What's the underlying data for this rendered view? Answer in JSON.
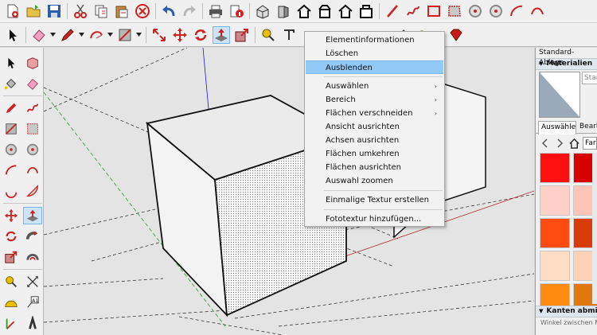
{
  "context_menu": {
    "items": [
      {
        "label": "Elementinformationen",
        "submenu": false,
        "highlighted": false
      },
      {
        "label": "Löschen",
        "submenu": false,
        "highlighted": false
      },
      {
        "label": "Ausblenden",
        "submenu": false,
        "highlighted": true
      },
      {
        "separator": true
      },
      {
        "label": "Auswählen",
        "submenu": true,
        "highlighted": false
      },
      {
        "label": "Bereich",
        "submenu": true,
        "highlighted": false
      },
      {
        "label": "Flächen verschneiden",
        "submenu": true,
        "highlighted": false
      },
      {
        "label": "Ansicht ausrichten",
        "submenu": false,
        "highlighted": false
      },
      {
        "label": "Achsen ausrichten",
        "submenu": false,
        "highlighted": false
      },
      {
        "label": "Flächen umkehren",
        "submenu": false,
        "highlighted": false
      },
      {
        "label": "Flächen ausrichten",
        "submenu": false,
        "highlighted": false
      },
      {
        "label": "Auswahl zoomen",
        "submenu": false,
        "highlighted": false
      },
      {
        "separator": true
      },
      {
        "label": "Einmalige Textur erstellen",
        "submenu": false,
        "highlighted": false
      },
      {
        "separator": true
      },
      {
        "label": "Fototextur hinzufügen...",
        "submenu": false,
        "highlighted": false
      }
    ],
    "submenu_arrow": "›"
  },
  "tray": {
    "title": "Standard-Ablage",
    "materials_header": "Materialien",
    "material_name_field": "Stan",
    "tab_select": "Auswählen",
    "tab_edit": "Bearb",
    "library_select": "Farb",
    "edges_header": "Kanten abmild",
    "angle_text": "Winkel zwischen No",
    "collapse_glyph": "▼",
    "swatch_colors": [
      "#ff1010",
      "#d80000",
      "#ffd0c8",
      "#ffc4b8",
      "#ff4a10",
      "#d83a08",
      "#ffdcc4",
      "#ffd2b8",
      "#ff8c10",
      "#e07810"
    ]
  },
  "toolbar_top": {
    "icons": [
      "new-icon",
      "open-icon",
      "save-icon",
      "cut-icon",
      "copy-icon",
      "paste-icon",
      "erase-icon",
      "undo-icon",
      "redo-icon",
      "print-icon",
      "model-info-icon",
      "iso-view-icon",
      "top-view-icon",
      "front-view-icon",
      "right-view-icon",
      "back-view-icon",
      "left-view-icon",
      "line-icon",
      "freehand-icon",
      "rectangle-icon",
      "rotated-rect-icon",
      "circle-icon",
      "polygon-icon",
      "arc-icon",
      "pie-icon"
    ]
  },
  "toolbar_second": {
    "icons": [
      "select-icon",
      "eraser-icon",
      "pencil-icon",
      "arc-tool-icon",
      "shape-icon",
      "offset-icon",
      "move-icon",
      "rotate-icon",
      "push-pull-icon",
      "scale-icon",
      "tape-measure-icon",
      "text-icon",
      "paint-icon",
      "components-icon",
      "ruby-icon"
    ]
  },
  "tool_palette": {
    "icons": [
      "select-arrow-icon",
      "make-component-icon",
      "paint-bucket-icon",
      "eraser-icon",
      "line-icon",
      "freehand-icon",
      "rectangle-icon",
      "rotated-rectangle-icon",
      "circle-icon",
      "polygon-icon",
      "arc-icon",
      "two-point-arc-icon",
      "three-point-arc-icon",
      "pie-icon",
      "move-icon",
      "push-pull-icon",
      "rotate-icon",
      "follow-me-icon",
      "scale-icon",
      "offset-icon",
      "tape-measure-icon",
      "dimension-icon",
      "protractor-icon",
      "text-label-icon",
      "axes-icon",
      "3d-text-icon"
    ],
    "active": "push-pull-icon",
    "text_label_glyph": "A1"
  },
  "colors": {
    "highlight": "#91c9f7",
    "axis_blue": "#1a1ad8",
    "axis_green": "#2e9e2e",
    "axis_red": "#b03030",
    "viewport_bg": "#e4e4e4"
  }
}
